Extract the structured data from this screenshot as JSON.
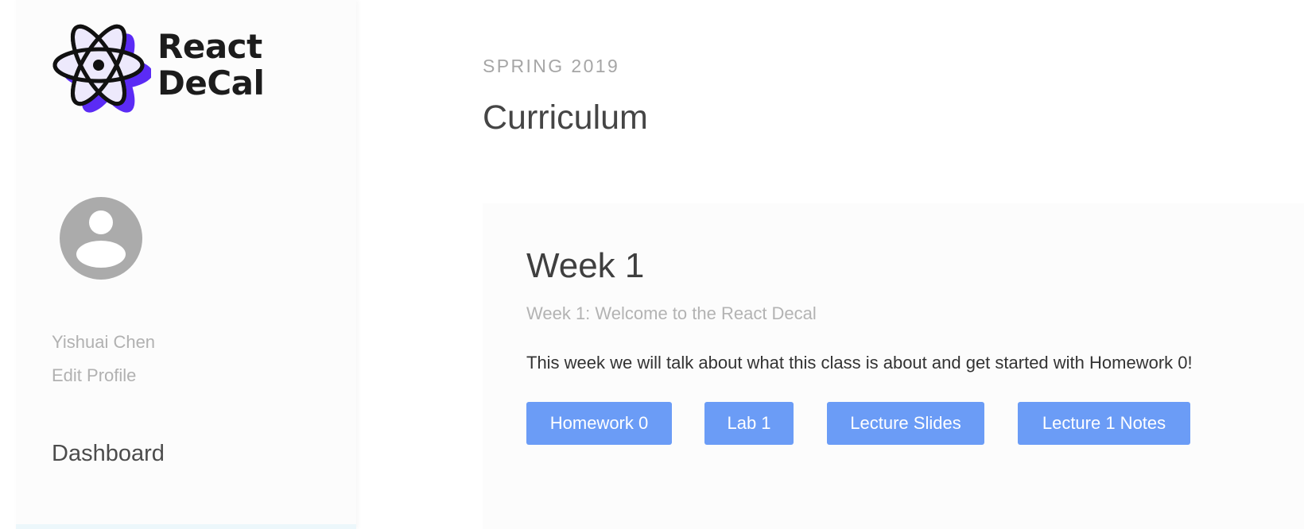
{
  "brand": {
    "line1": "React",
    "line2": "DeCal",
    "accent_color": "#5b2bf5",
    "icon": "react-atom-icon"
  },
  "user": {
    "name": "Yishuai Chen",
    "edit_profile_label": "Edit Profile",
    "avatar_icon": "user-avatar-icon"
  },
  "nav": {
    "dashboard_label": "Dashboard"
  },
  "header": {
    "semester": "SPRING 2019",
    "title": "Curriculum"
  },
  "weeks": [
    {
      "title": "Week 1",
      "subtitle": "Week 1: Welcome to the React Decal",
      "description": "This week we will talk about what this class is about and get started with Homework 0!",
      "buttons": [
        "Homework 0",
        "Lab 1",
        "Lecture Slides",
        "Lecture 1 Notes"
      ]
    }
  ],
  "colors": {
    "button_bg": "#6b9cf6",
    "sidebar_bg": "#fcfcfc"
  }
}
